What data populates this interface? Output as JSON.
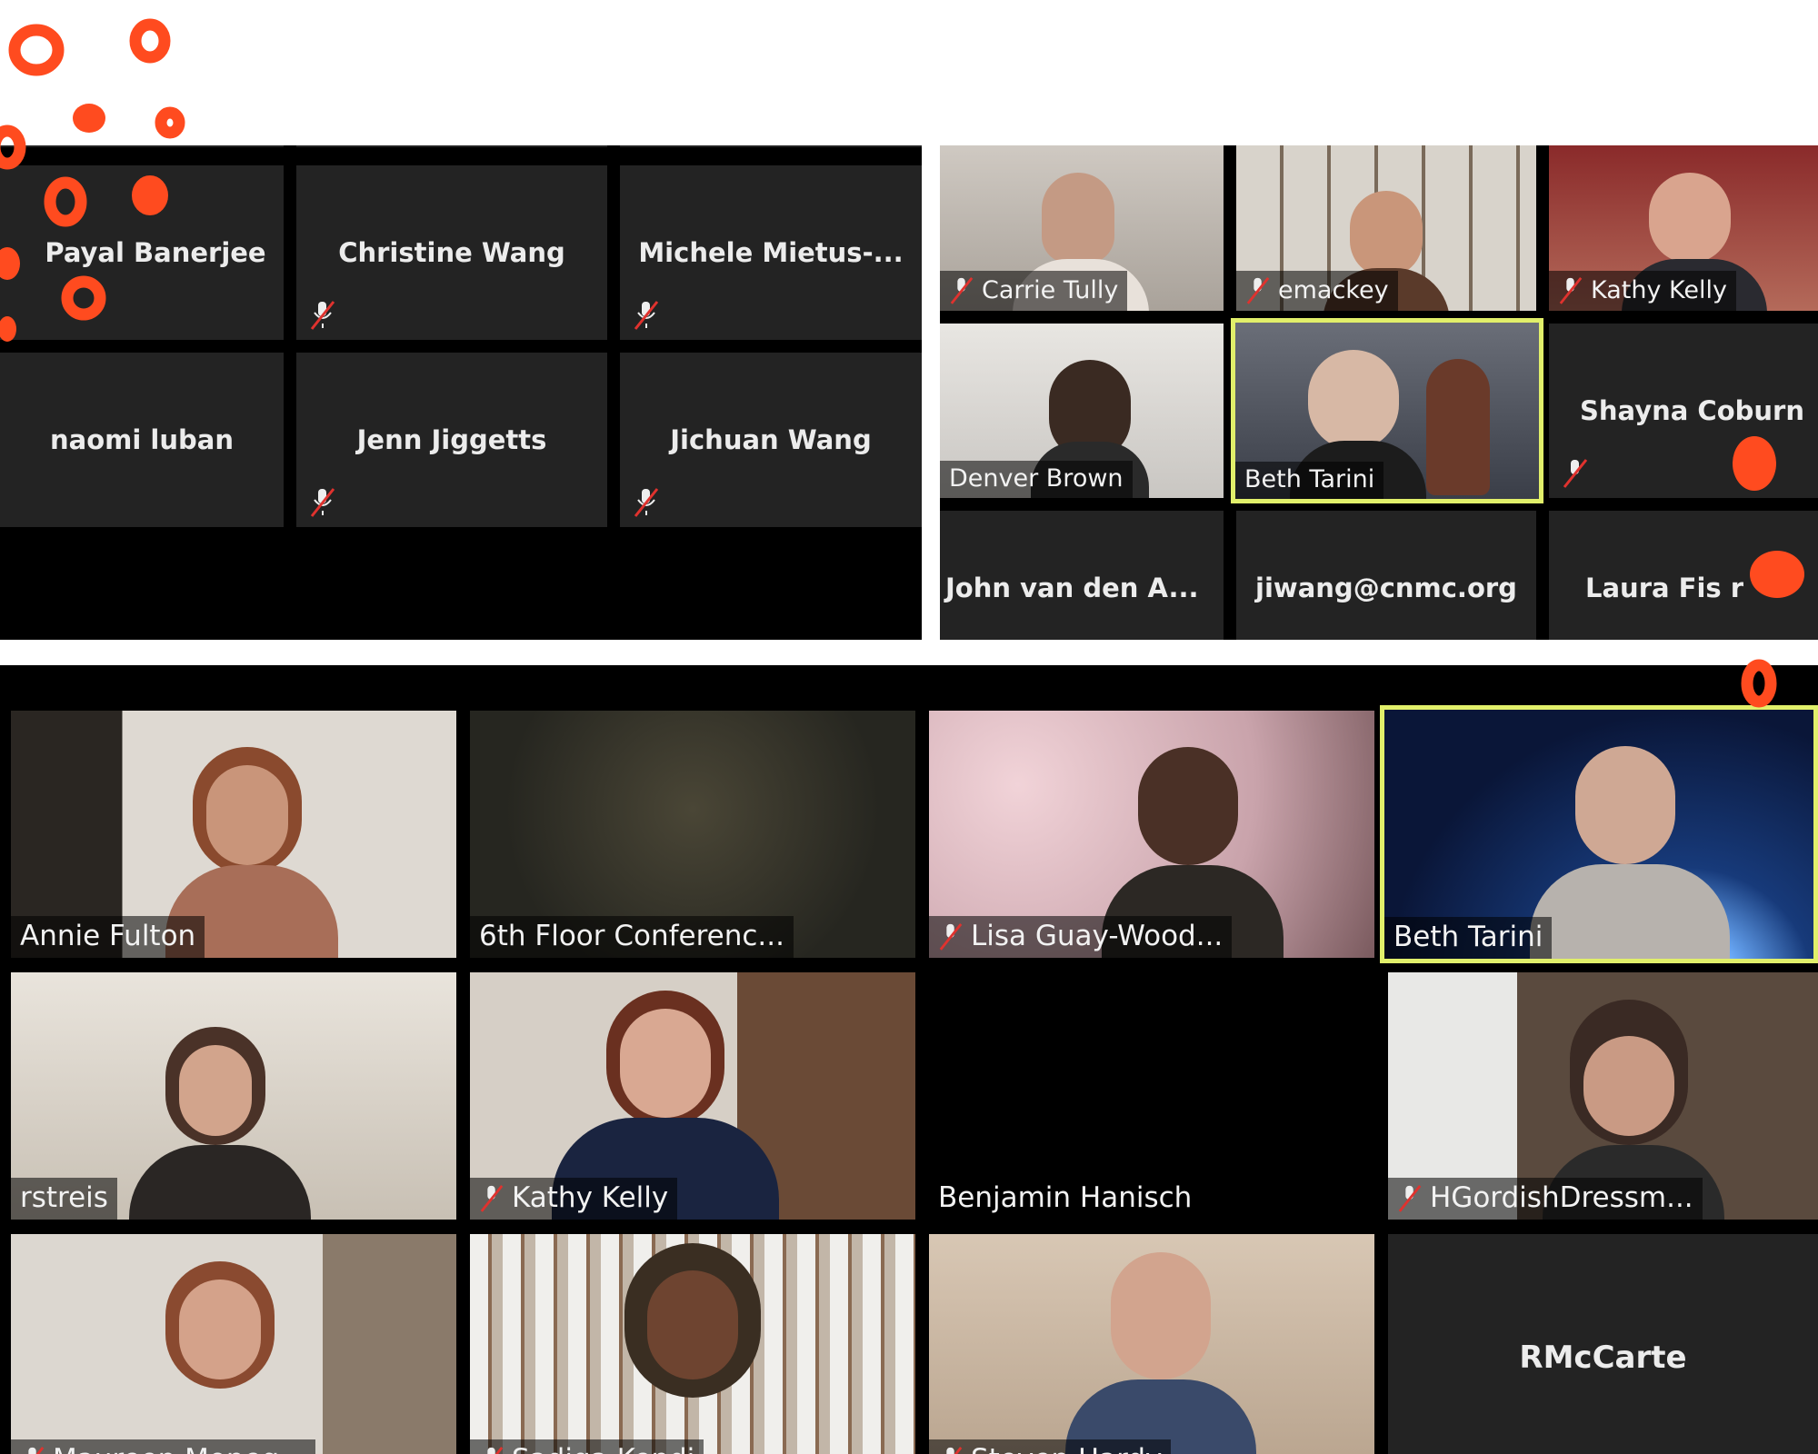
{
  "colors": {
    "annotation": "#ff4b1f",
    "active_speaker": "#e1ef6a",
    "tile_bg": "#232323",
    "muted": "#e0322e"
  },
  "grid_left": {
    "tiles": [
      {
        "name": "Payal Banerjee",
        "muted": false
      },
      {
        "name": "Christine Wang",
        "muted": true
      },
      {
        "name": "Michele  Mietus-...",
        "muted": true
      },
      {
        "name": "naomi luban",
        "muted": false
      },
      {
        "name": "Jenn Jiggetts",
        "muted": true
      },
      {
        "name": "Jichuan Wang",
        "muted": true
      }
    ]
  },
  "grid_right": {
    "tiles": [
      {
        "name": "Carrie Tully",
        "muted": true
      },
      {
        "name": "emackey",
        "muted": true
      },
      {
        "name": "Kathy Kelly",
        "muted": true
      },
      {
        "name": "Denver Brown",
        "muted": false
      },
      {
        "name": "Beth Tarini",
        "muted": false,
        "active": true
      },
      {
        "name": "Shayna Coburn",
        "muted": true
      },
      {
        "name": "John van  den A...",
        "muted": false
      },
      {
        "name": "jiwang@cnmc.org",
        "muted": false
      },
      {
        "name": "Laura Fis  r",
        "muted": false
      }
    ]
  },
  "grid_bottom": {
    "tiles": [
      {
        "name": "Annie Fulton",
        "muted": false
      },
      {
        "name": "6th Floor Conferenc...",
        "muted": false
      },
      {
        "name": "Lisa Guay-Wood...",
        "muted": true
      },
      {
        "name": "Beth Tarini",
        "muted": false,
        "active": true
      },
      {
        "name": "rstreis",
        "muted": false
      },
      {
        "name": "Kathy Kelly",
        "muted": true
      },
      {
        "name": "Benjamin Hanisch",
        "muted": false
      },
      {
        "name": "HGordishDressm...",
        "muted": true
      },
      {
        "name": "Maureen Moneg...",
        "muted": true
      },
      {
        "name": "Sadiqa Kendi",
        "muted": true
      },
      {
        "name": "Steven Hardy",
        "muted": true
      },
      {
        "name": "RMcCarte",
        "muted": false
      }
    ]
  }
}
